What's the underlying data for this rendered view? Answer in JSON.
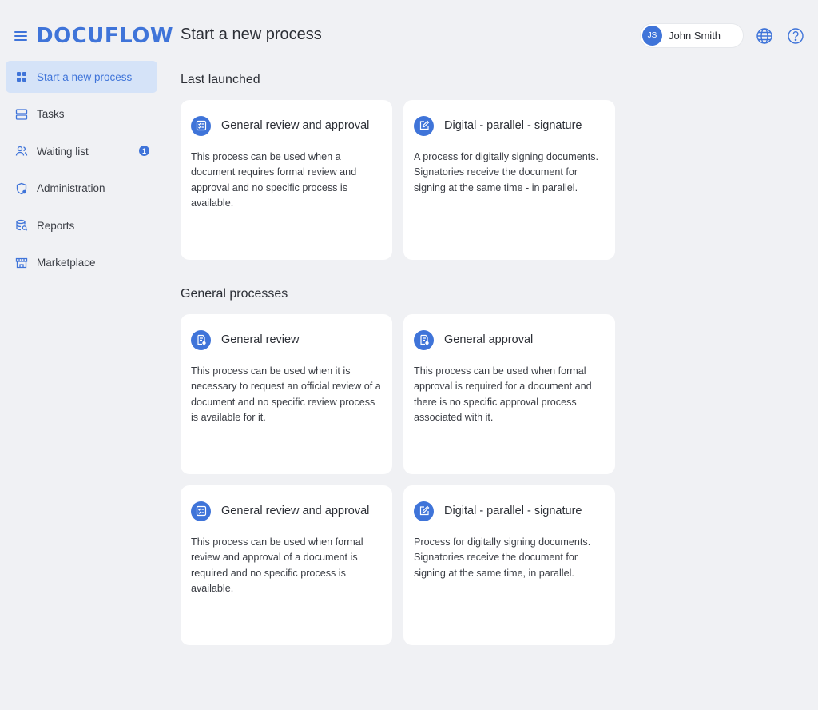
{
  "brand": {
    "logo": "DOCUFLOW"
  },
  "header": {
    "title": "Start a new process"
  },
  "user": {
    "initials": "JS",
    "name": "John Smith"
  },
  "sidebar": {
    "items": [
      {
        "label": "Start a new process",
        "icon": "grid-icon"
      },
      {
        "label": "Tasks",
        "icon": "tasks-icon"
      },
      {
        "label": "Waiting list",
        "icon": "users-icon",
        "badge": "1"
      },
      {
        "label": "Administration",
        "icon": "shield-icon"
      },
      {
        "label": "Reports",
        "icon": "database-search-icon"
      },
      {
        "label": "Marketplace",
        "icon": "store-icon"
      }
    ]
  },
  "sections": {
    "last_launched": {
      "title": "Last launched",
      "cards": [
        {
          "title": "General review and approval",
          "icon": "checklist-icon",
          "description": "This process can be used when a document requires formal review and approval and no specific process is available."
        },
        {
          "title": "Digital - parallel - signature",
          "icon": "edit-icon",
          "description": "A process for digitally signing documents. Signatories receive the document for signing at the same time - in parallel."
        }
      ]
    },
    "general": {
      "title": "General processes",
      "cards": [
        {
          "title": "General review",
          "icon": "document-check-icon",
          "description": "This process can be used when it is necessary to request an official review of a document and no specific review process is available for it."
        },
        {
          "title": "General approval",
          "icon": "document-check-icon",
          "description": "This process can be used when formal approval is required for a document and there is no specific approval process associated with it."
        },
        {
          "title": "General review and approval",
          "icon": "checklist-icon",
          "description": "This process can be used when formal review and approval of a document is required and no specific process is available."
        },
        {
          "title": "Digital - parallel - signature",
          "icon": "edit-icon",
          "description": "Process for digitally signing documents. Signatories receive the document for signing at the same time, in parallel."
        }
      ]
    }
  },
  "colors": {
    "accent": "#3f74d9",
    "background": "#f0f1f4",
    "active_nav": "#d5e3f8"
  }
}
